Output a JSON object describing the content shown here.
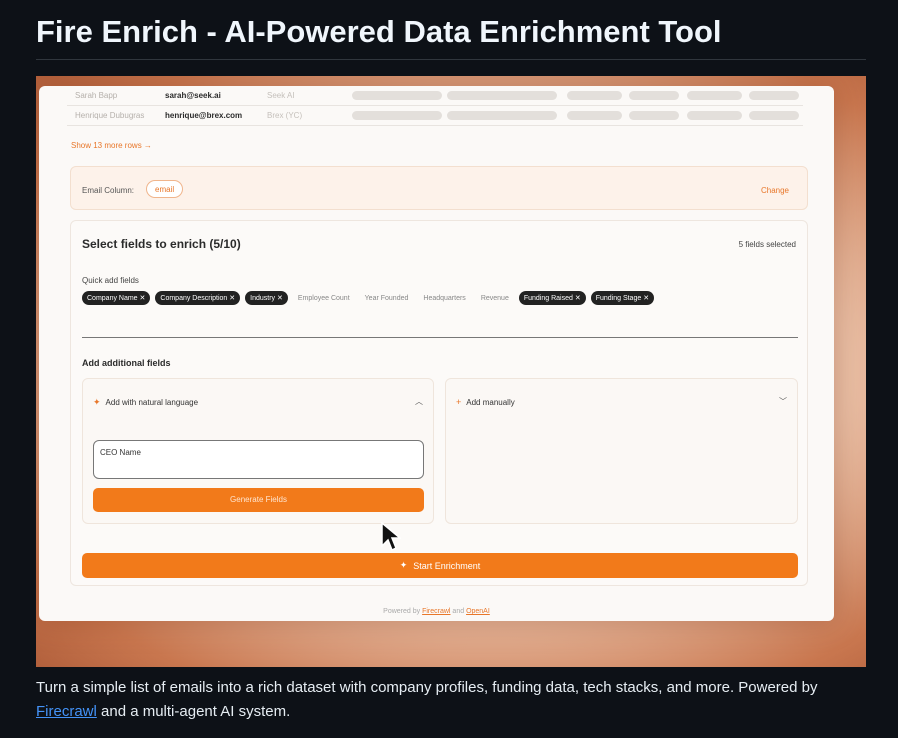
{
  "page": {
    "title": "Fire Enrich - AI-Powered Data Enrichment Tool",
    "description_part1": "Turn a simple list of emails into a rich dataset with company profiles, funding data, tech stacks, and more. Powered by ",
    "description_link": "Firecrawl",
    "description_part2": " and a multi-agent AI system."
  },
  "app": {
    "rows": [
      {
        "name": "Sarah Bapp",
        "email": "sarah@seek.ai",
        "company": "Seek AI"
      },
      {
        "name": "Henrique Dubugras",
        "email": "henrique@brex.com",
        "company": "Brex (YC)"
      }
    ],
    "show_more": "Show 13 more rows →",
    "email_column": {
      "label": "Email Column:",
      "chip": "email",
      "change": "Change"
    },
    "fields": {
      "title": "Select fields to enrich (5/10)",
      "count": "5 fields selected",
      "quick_label": "Quick add fields",
      "chips": [
        {
          "label": "Company Name",
          "selected": true
        },
        {
          "label": "Company Description",
          "selected": true
        },
        {
          "label": "Industry",
          "selected": true
        },
        {
          "label": "Employee Count",
          "selected": false
        },
        {
          "label": "Year Founded",
          "selected": false
        },
        {
          "label": "Headquarters",
          "selected": false
        },
        {
          "label": "Revenue",
          "selected": false
        },
        {
          "label": "Funding Raised",
          "selected": true
        },
        {
          "label": "Funding Stage",
          "selected": true
        }
      ],
      "additional_label": "Add additional fields",
      "natural_language": {
        "label": "Add with natural language",
        "input_value": "CEO Name",
        "button": "Generate Fields"
      },
      "manual": {
        "label": "Add manually"
      },
      "start_button": "Start Enrichment"
    },
    "footer": {
      "prefix": "Powered by ",
      "firecrawl": "Firecrawl",
      "and": " and ",
      "openai": "OpenAI"
    }
  },
  "colors": {
    "accent": "#f27a1a",
    "link": "#4493f8",
    "background": "#0d1117"
  }
}
